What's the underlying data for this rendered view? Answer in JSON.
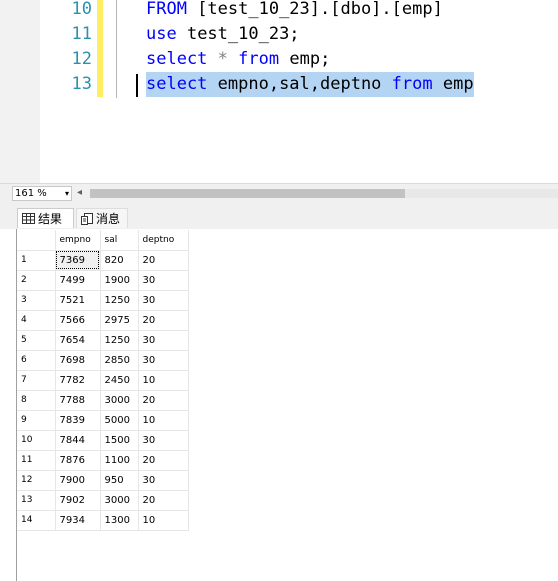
{
  "editor": {
    "lines": [
      {
        "num": "10",
        "parts": [
          {
            "t": "FROM",
            "c": "kw"
          },
          {
            "t": " [test_10_23].[dbo].[emp]",
            "c": ""
          }
        ]
      },
      {
        "num": "11",
        "parts": [
          {
            "t": "use",
            "c": "kw"
          },
          {
            "t": " test_10_23;",
            "c": ""
          }
        ]
      },
      {
        "num": "12",
        "parts": [
          {
            "t": "select",
            "c": "kw"
          },
          {
            "t": " ",
            "c": ""
          },
          {
            "t": "*",
            "c": "gray"
          },
          {
            "t": " ",
            "c": ""
          },
          {
            "t": "from",
            "c": "kw"
          },
          {
            "t": " emp;",
            "c": ""
          }
        ]
      },
      {
        "num": "13",
        "parts": [
          {
            "t": "select",
            "c": "kw"
          },
          {
            "t": " empno,sal,deptno ",
            "c": ""
          },
          {
            "t": "from",
            "c": "kw"
          },
          {
            "t": " emp",
            "c": ""
          }
        ],
        "highlighted": true
      }
    ]
  },
  "statusbar": {
    "zoom": "161 %",
    "zoom_arrow": "▾",
    "scroll_left": "◂"
  },
  "tabs": [
    {
      "label": "结果",
      "icon": "grid-icon",
      "active": true
    },
    {
      "label": "消息",
      "icon": "message-icon",
      "active": false
    }
  ],
  "grid": {
    "columns": [
      "empno",
      "sal",
      "deptno"
    ],
    "rows": [
      {
        "n": "1",
        "empno": "7369",
        "sal": "820",
        "deptno": "20"
      },
      {
        "n": "2",
        "empno": "7499",
        "sal": "1900",
        "deptno": "30"
      },
      {
        "n": "3",
        "empno": "7521",
        "sal": "1250",
        "deptno": "30"
      },
      {
        "n": "4",
        "empno": "7566",
        "sal": "2975",
        "deptno": "20"
      },
      {
        "n": "5",
        "empno": "7654",
        "sal": "1250",
        "deptno": "30"
      },
      {
        "n": "6",
        "empno": "7698",
        "sal": "2850",
        "deptno": "30"
      },
      {
        "n": "7",
        "empno": "7782",
        "sal": "2450",
        "deptno": "10"
      },
      {
        "n": "8",
        "empno": "7788",
        "sal": "3000",
        "deptno": "20"
      },
      {
        "n": "9",
        "empno": "7839",
        "sal": "5000",
        "deptno": "10"
      },
      {
        "n": "10",
        "empno": "7844",
        "sal": "1500",
        "deptno": "30"
      },
      {
        "n": "11",
        "empno": "7876",
        "sal": "1100",
        "deptno": "20"
      },
      {
        "n": "12",
        "empno": "7900",
        "sal": "950",
        "deptno": "30"
      },
      {
        "n": "13",
        "empno": "7902",
        "sal": "3000",
        "deptno": "20"
      },
      {
        "n": "14",
        "empno": "7934",
        "sal": "1300",
        "deptno": "10"
      }
    ]
  }
}
